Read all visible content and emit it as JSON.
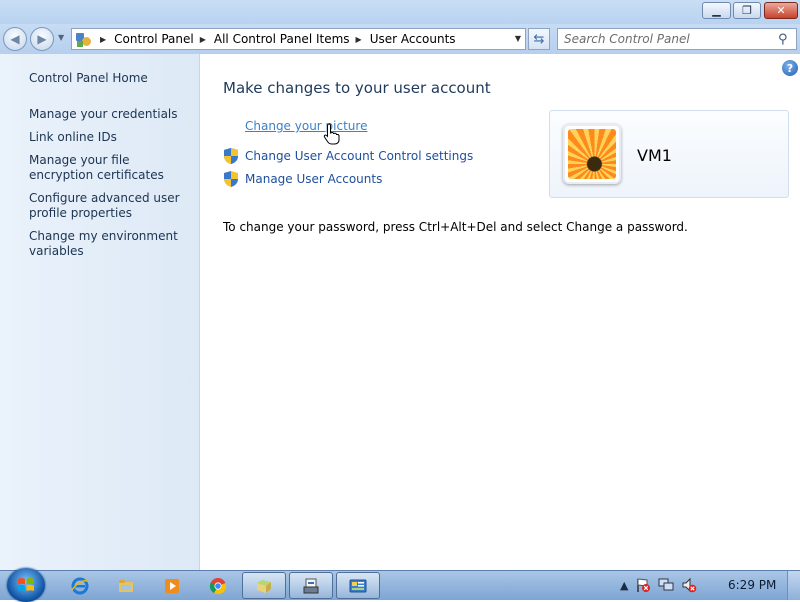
{
  "window": {
    "minimize_icon": "minimize-icon",
    "maximize_icon": "restore-icon",
    "close_icon": "close-icon"
  },
  "nav": {
    "breadcrumbs": [
      "Control Panel",
      "All Control Panel Items",
      "User Accounts"
    ],
    "search_placeholder": "Search Control Panel"
  },
  "sidebar": {
    "home": "Control Panel Home",
    "links": [
      "Manage your credentials",
      "Link online IDs",
      "Manage your file encryption certificates",
      "Configure advanced user profile properties",
      "Change my environment variables"
    ]
  },
  "main": {
    "title": "Make changes to your user account",
    "tasks": [
      "Change your picture",
      "Change User Account Control settings",
      "Manage User Accounts"
    ],
    "user_name": "VM1",
    "password_note": "To change your password, press Ctrl+Alt+Del and select Change a password."
  },
  "taskbar": {
    "clock": "6:29 PM",
    "pinned": [
      "internet-explorer-icon",
      "explorer-icon",
      "media-player-icon",
      "chrome-icon",
      "folder-icon",
      "scanner-icon",
      "control-panel-icon"
    ]
  },
  "colors": {
    "link": "#1e4f9c",
    "title": "#1e3a5c",
    "sidebar_bg": "#eaf2fb"
  }
}
